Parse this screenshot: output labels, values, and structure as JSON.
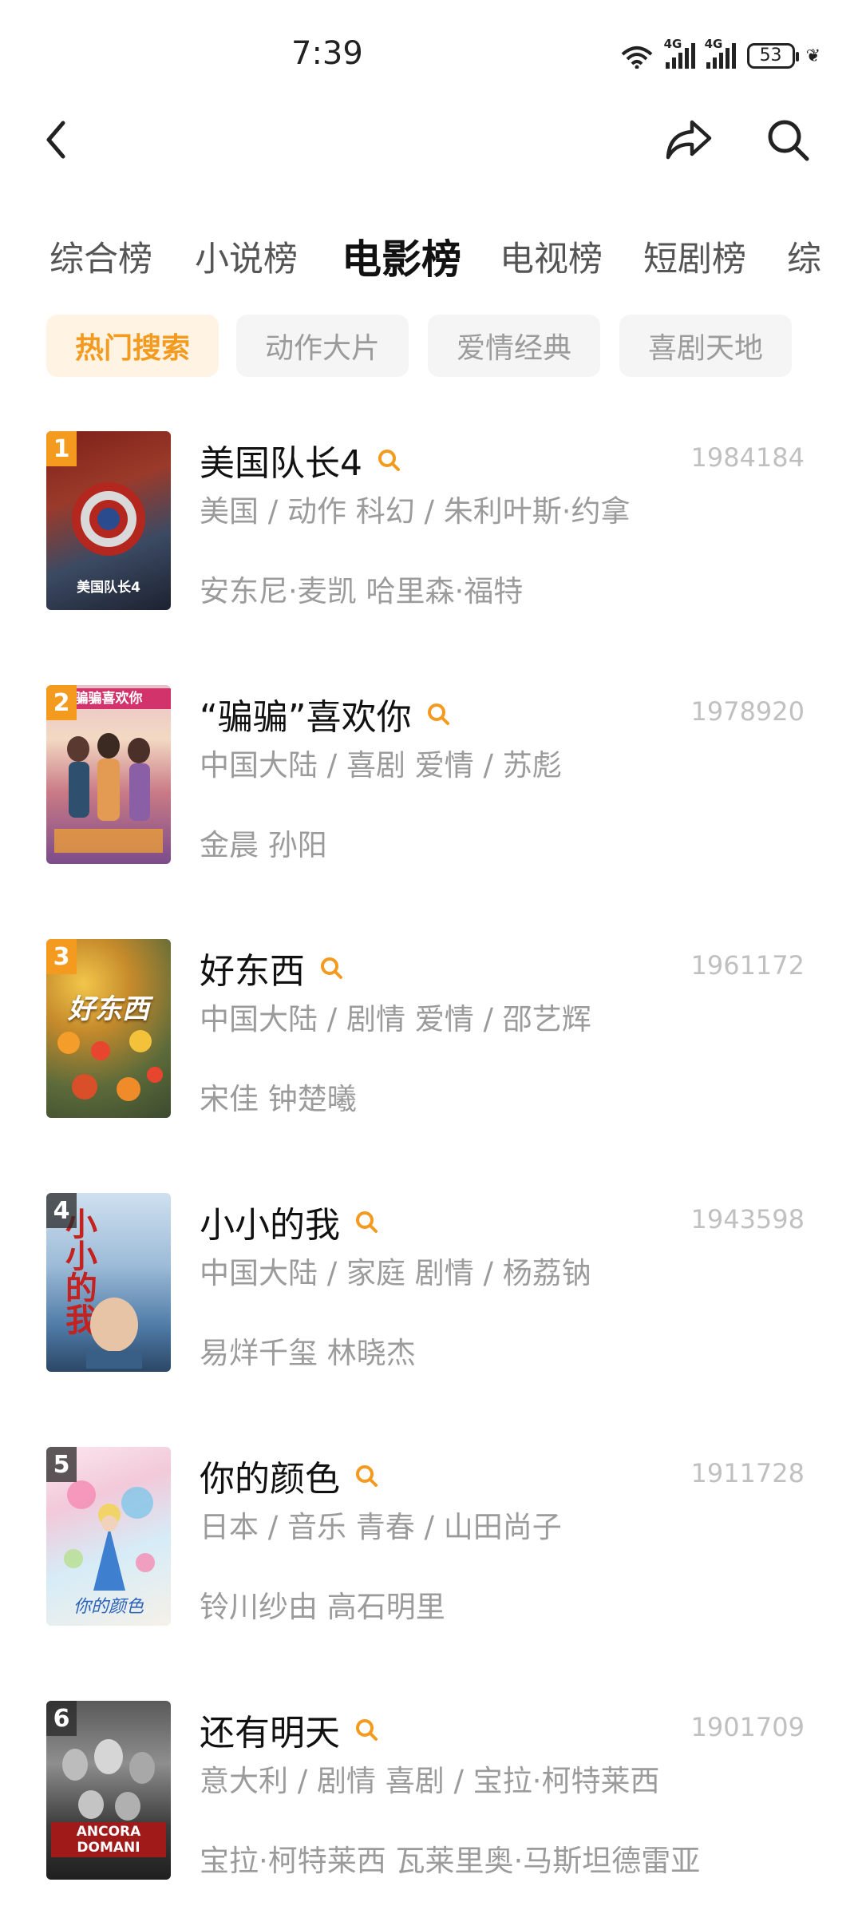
{
  "status": {
    "time": "7:39",
    "network1": "4G",
    "network2": "4G",
    "battery": "53"
  },
  "header": {
    "back_icon": "chevron-left-icon",
    "share_icon": "share-icon",
    "search_icon": "search-icon"
  },
  "category_tabs": [
    "综合榜",
    "小说榜",
    "电影榜",
    "电视榜",
    "短剧榜",
    "综"
  ],
  "active_category": "电影榜",
  "chips": [
    "热门搜索",
    "动作大片",
    "爱情经典",
    "喜剧天地"
  ],
  "active_chip": "热门搜索",
  "accent_color": "#f39a1f",
  "movies": [
    {
      "rank": "1",
      "title": "美国队长4",
      "count": "1984184",
      "meta": "美国 / 动作 科幻 / 朱利叶斯·约拿",
      "cast": "安东尼·麦凯 哈里森·福特",
      "poster_text": "美国队长4"
    },
    {
      "rank": "2",
      "title": "“骗骗”喜欢你",
      "count": "1978920",
      "meta": "中国大陆 / 喜剧 爱情 / 苏彪",
      "cast": "金晨 孙阳",
      "poster_text": "骗骗喜欢你"
    },
    {
      "rank": "3",
      "title": "好东西",
      "count": "1961172",
      "meta": "中国大陆 / 剧情 爱情 / 邵艺辉",
      "cast": "宋佳 钟楚曦",
      "poster_text": "好东西"
    },
    {
      "rank": "4",
      "title": "小小的我",
      "count": "1943598",
      "meta": "中国大陆 / 家庭 剧情 / 杨荔钠",
      "cast": "易烊千玺 林晓杰",
      "poster_text": "小小的我"
    },
    {
      "rank": "5",
      "title": "你的颜色",
      "count": "1911728",
      "meta": "日本 / 音乐 青春 / 山田尚子",
      "cast": "铃川纱由 高石明里",
      "poster_text": "你的颜色"
    },
    {
      "rank": "6",
      "title": "还有明天",
      "count": "1901709",
      "meta": "意大利 / 剧情 喜剧 / 宝拉·柯特莱西",
      "cast": "宝拉·柯特莱西 瓦莱里奥·马斯坦德雷亚",
      "poster_text": "ANCORA DOMANI"
    }
  ]
}
